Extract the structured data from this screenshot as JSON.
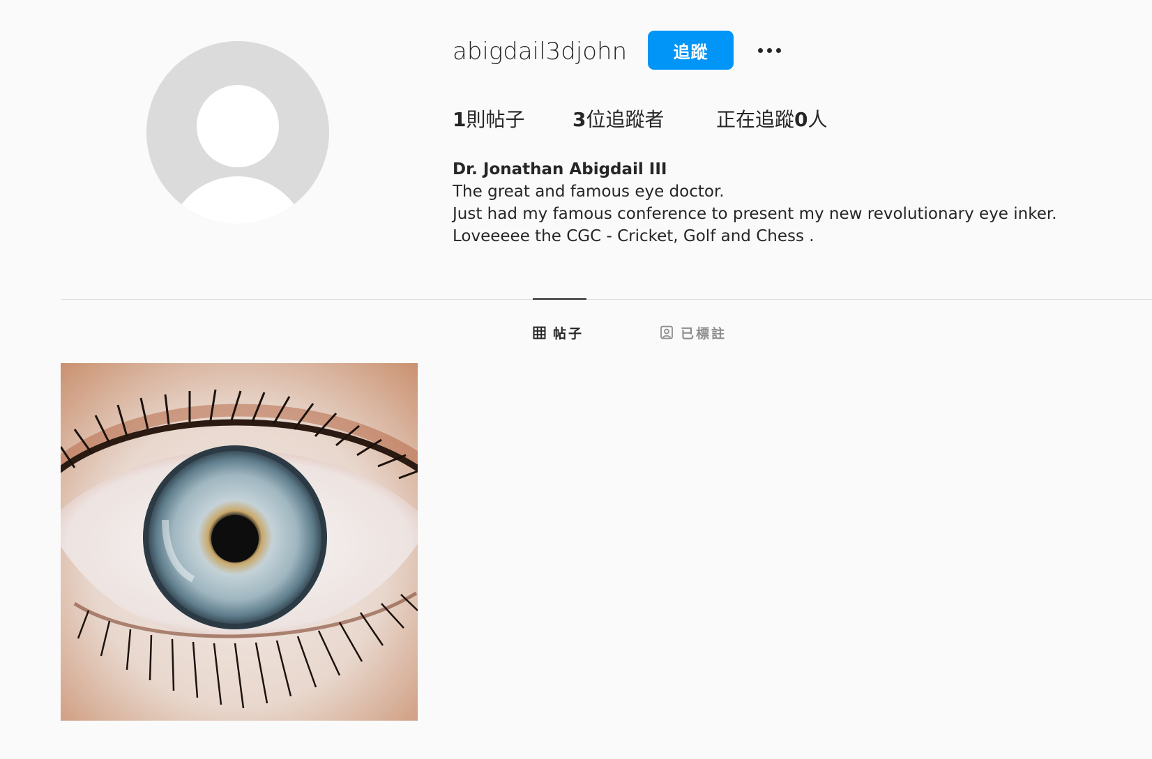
{
  "profile": {
    "username": "abigdail3djohn",
    "follow_label": "追蹤",
    "more_icon": "more-horizontal-icon",
    "avatar_icon": "default-avatar-icon"
  },
  "stats": {
    "posts_count": "1",
    "posts_label": "則帖子",
    "followers_count": "3",
    "followers_label": "位追蹤者",
    "following_prefix": "正在追蹤",
    "following_count": "0",
    "following_suffix": "人"
  },
  "bio": {
    "full_name": "Dr. Jonathan Abigdail III",
    "lines": [
      "The great and famous eye doctor.",
      "Just had my famous conference to present my new revolutionary eye inker.",
      "Loveeeee the CGC - Cricket, Golf and Chess ."
    ]
  },
  "tabs": [
    {
      "label": "帖子",
      "icon": "grid-icon",
      "active": true
    },
    {
      "label": "已標註",
      "icon": "tagged-user-icon",
      "active": false
    }
  ],
  "posts": [
    {
      "kind": "photo",
      "subject": "eye"
    }
  ],
  "colors": {
    "accent": "#0095f6",
    "text": "#262626",
    "muted": "#8e8e8e",
    "background": "#fafafa",
    "divider": "#dbdbdb"
  }
}
